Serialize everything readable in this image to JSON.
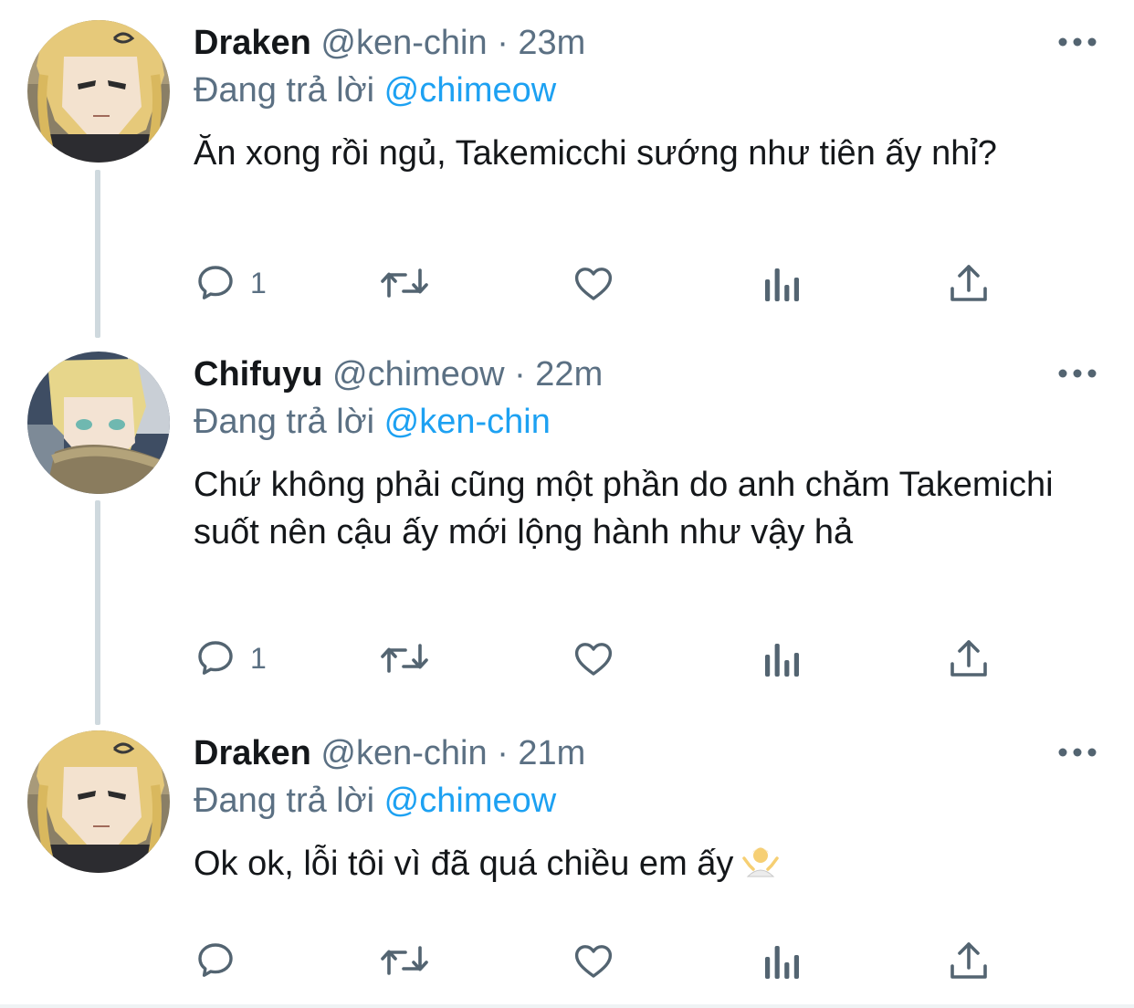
{
  "tweets": [
    {
      "name": "Draken",
      "handle": "@ken-chin",
      "separator": "·",
      "time": "23m",
      "reply_prefix": "Đang trả lời",
      "reply_to": "@chimeow",
      "text": "Ăn xong rồi ngủ, Takemicchi sướng như tiên ấy nhỉ?",
      "reply_count": "1",
      "avatar": "draken-avatar"
    },
    {
      "name": "Chifuyu",
      "handle": "@chimeow",
      "separator": "·",
      "time": "22m",
      "reply_prefix": "Đang trả lời",
      "reply_to": "@ken-chin",
      "text": "Chứ không phải cũng một phần do anh chăm Takemichi suốt nên cậu ấy mới lộng hành như vậy hả",
      "reply_count": "1",
      "avatar": "chifuyu-avatar"
    },
    {
      "name": "Draken",
      "handle": "@ken-chin",
      "separator": "·",
      "time": "21m",
      "reply_prefix": "Đang trả lời",
      "reply_to": "@chimeow",
      "text": "Ok ok, lỗi tôi vì đã quá chiều em ấy",
      "reply_count": "",
      "avatar": "draken-avatar",
      "emoji": "man-shrugging-emoji"
    }
  ],
  "icons": {
    "reply": "reply-icon",
    "retweet": "retweet-icon",
    "like": "like-icon",
    "analytics": "analytics-icon",
    "share": "share-icon",
    "more": "more-icon"
  },
  "colors": {
    "text": "#14171a",
    "muted": "#5b7083",
    "link": "#1da1f2",
    "icon": "#536471",
    "thread_line": "#cfd9de"
  }
}
